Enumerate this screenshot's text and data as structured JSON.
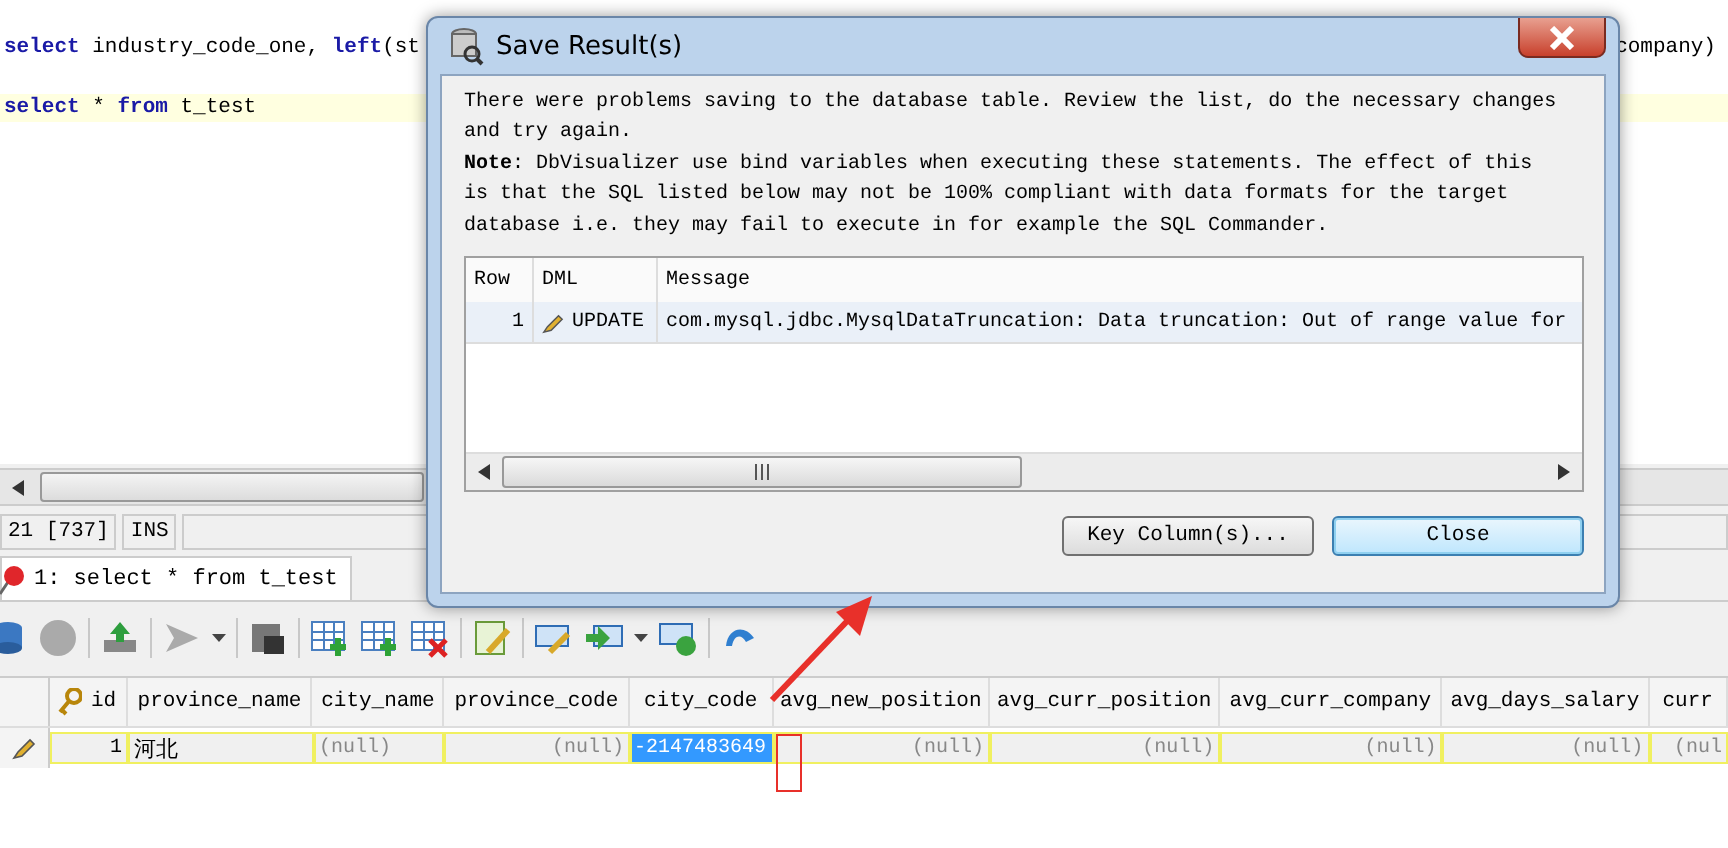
{
  "editor": {
    "lines": [
      {
        "text": "**select** industry_code_one, **left**(st",
        "tail": "company)",
        "current": false
      },
      {
        "text": "**select** * **from** t_test",
        "current": true
      }
    ]
  },
  "status_bar": [
    "21 [737]",
    "INS"
  ],
  "tabs": [
    {
      "label": "1: select * from t_test",
      "selected": true
    }
  ],
  "grid": {
    "columns": [
      "id",
      "province_name",
      "city_name",
      "province_code",
      "city_code",
      "avg_new_position",
      "avg_curr_position",
      "avg_curr_company",
      "avg_days_salary",
      "curr"
    ],
    "rows": [
      {
        "edited": true,
        "cells": [
          {
            "text": "1",
            "kind": "number",
            "selected": false
          },
          {
            "text": "河北",
            "kind": "text",
            "selected": false
          },
          {
            "text": "(null)",
            "kind": "null",
            "selected": false
          },
          {
            "text": "(null)",
            "kind": "null",
            "selected": false
          },
          {
            "text": "-2147483649",
            "kind": "number",
            "selected": true
          },
          {
            "text": "(null)",
            "kind": "null",
            "selected": false
          },
          {
            "text": "(null)",
            "kind": "null",
            "selected": false
          },
          {
            "text": "(null)",
            "kind": "null",
            "selected": false
          },
          {
            "text": "(null)",
            "kind": "null",
            "selected": false
          },
          {
            "text": "(nul",
            "kind": "null",
            "selected": false
          }
        ]
      }
    ]
  },
  "dialog": {
    "title": "Save Result(s)",
    "paragraphs": [
      "There were problems saving to the database table. Review the list, do the necessary changes and try again.",
      "**Note**: DbVisualizer use bind variables when executing these statements. The effect of this is that the SQL listed below may not be 100% compliant with data formats for the target database i.e. they may fail to execute in for example the SQL Commander."
    ],
    "table": {
      "columns": [
        "Row",
        "DML",
        "Message"
      ],
      "rows": [
        {
          "row": "1",
          "dml": "UPDATE",
          "message": "com.mysql.jdbc.MysqlDataTruncation: Data truncation: Out of range value for"
        }
      ]
    },
    "buttons": [
      {
        "label": "Key Column(s)...",
        "default": false
      },
      {
        "label": "Close",
        "default": true
      }
    ]
  }
}
